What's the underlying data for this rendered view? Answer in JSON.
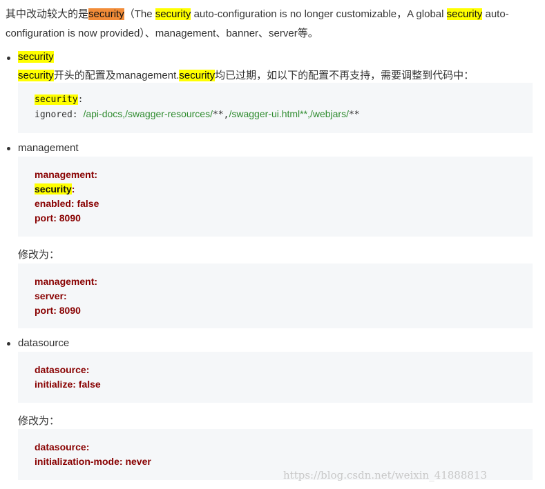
{
  "intro": {
    "t1": "其中改动较大的是",
    "t2": "security",
    "t3": "（The ",
    "t4": "security",
    "t5": " auto-configuration is no longer customizable，A global ",
    "t6": "security",
    "t7": " auto-configuration is now provided）、management、banner、server等。"
  },
  "items": {
    "security": {
      "title": "security",
      "desc_kw": "security",
      "desc_mid": "开头的配置及management.",
      "desc_kw2": "security",
      "desc_tail": "均已过期，如以下的配置不再支持，需要调整到代码中：",
      "code_key": "security",
      "code_colon": ":",
      "code_ignored": "ignored: ",
      "code_s1": "/api-docs,/swagger-resources/",
      "code_s2": "**,",
      "code_s3": "/swagger-ui.html**,/webjars/",
      "code_s4": "**"
    },
    "management": {
      "title": "management",
      "before": [
        "management:",
        "security",
        "enabled: false",
        "port: 8090"
      ],
      "before_colon": ":",
      "change_label": "修改为：",
      "after": [
        "management:",
        "server:",
        "port: 8090"
      ]
    },
    "datasource": {
      "title": "datasource",
      "before": [
        "datasource:",
        "initialize: false"
      ],
      "change_label": "修改为：",
      "after": [
        "datasource:",
        "initialization-mode: never"
      ]
    }
  },
  "watermark": "https://blog.csdn.net/weixin_41888813"
}
